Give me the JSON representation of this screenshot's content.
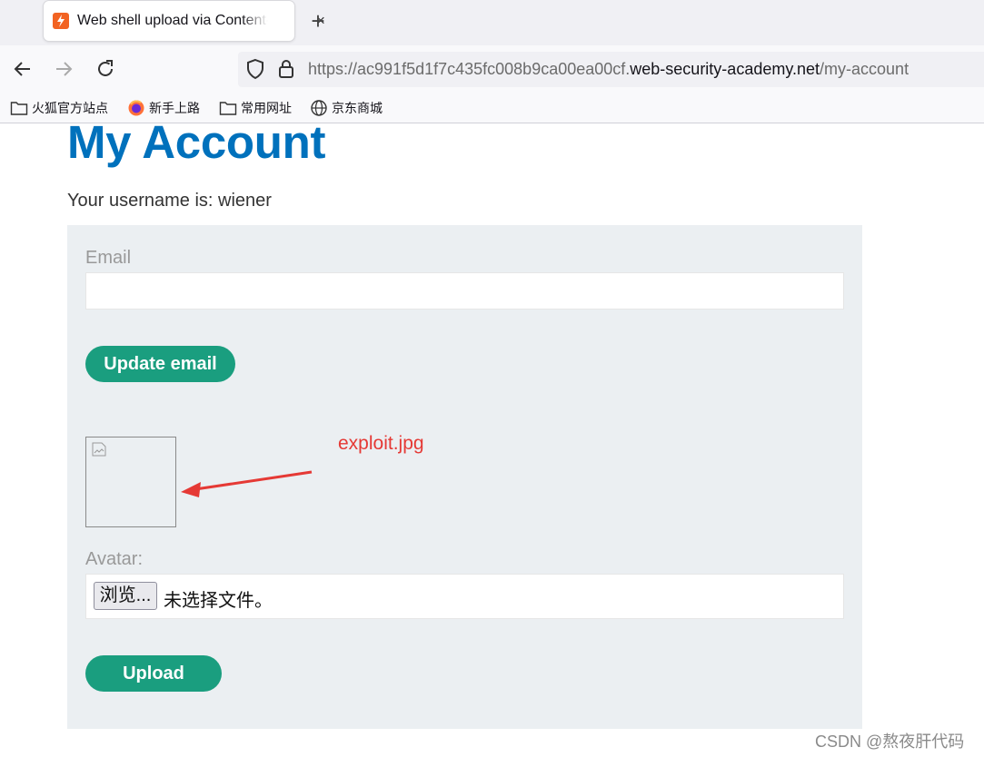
{
  "browser": {
    "tab_title": "Web shell upload via Content-Type restriction bypass",
    "tab_close": "×",
    "new_tab": "+",
    "url": {
      "prefix": "https://ac991f5d1f7c435fc008b9ca00ea00cf.",
      "domain": "web-security-academy.net",
      "path": "/my-account"
    },
    "bookmarks": [
      {
        "label": "火狐官方站点",
        "icon": "folder-icon"
      },
      {
        "label": "新手上路",
        "icon": "firefox-icon"
      },
      {
        "label": "常用网址",
        "icon": "folder-icon"
      },
      {
        "label": "京东商城",
        "icon": "globe-icon"
      }
    ]
  },
  "page": {
    "title": "My Account",
    "username_line": "Your username is: wiener",
    "email_label": "Email",
    "email_value": "",
    "update_email_button": "Update email",
    "avatar_label": "Avatar:",
    "file_button": "浏览...",
    "file_status": "未选择文件。",
    "upload_button": "Upload"
  },
  "annotation": {
    "text": "exploit.jpg",
    "color": "#e53935"
  },
  "watermark": "CSDN @熬夜肝代码",
  "colors": {
    "accent_blue": "#0071bc",
    "button_green": "#1a9e7f",
    "panel_bg": "#ebeff2"
  }
}
